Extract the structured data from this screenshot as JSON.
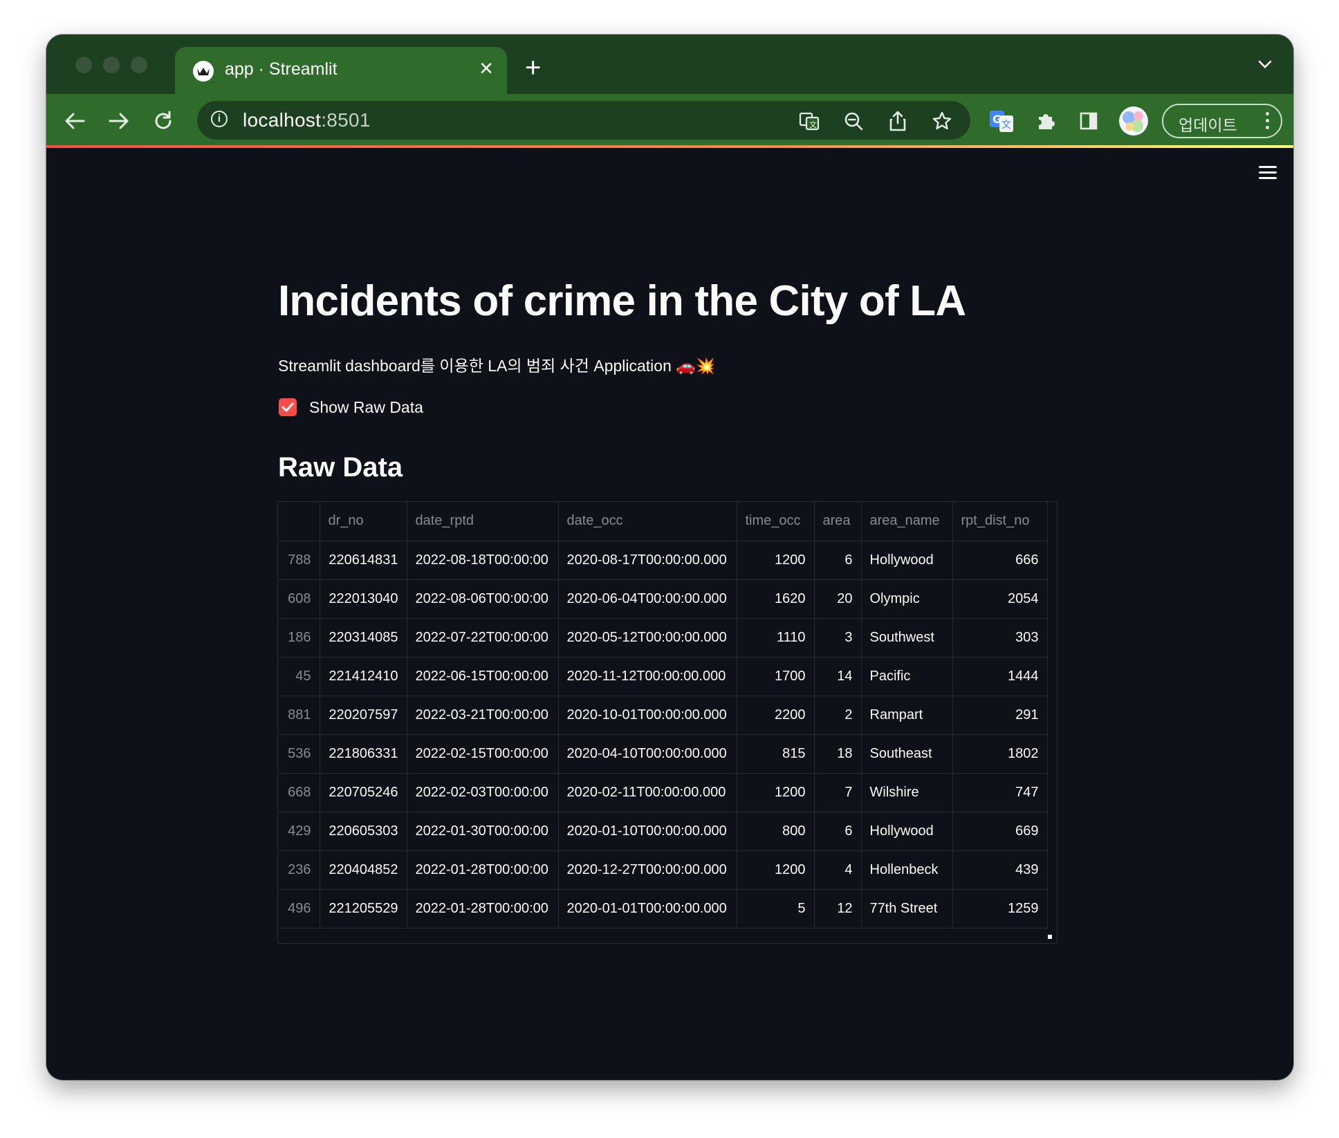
{
  "browser": {
    "tab_title": "app · Streamlit",
    "url_host": "localhost",
    "url_port": ":8501",
    "update_label": "업데이트"
  },
  "app": {
    "title": "Incidents of crime in the City of LA",
    "subtitle": "Streamlit dashboard를 이용한 LA의 범죄 사건 Application 🚗💥",
    "checkbox_label": "Show Raw Data",
    "checkbox_checked": true,
    "section_title": "Raw Data"
  },
  "table": {
    "columns": [
      "",
      "dr_no",
      "date_rptd",
      "date_occ",
      "time_occ",
      "area",
      "area_name",
      "rpt_dist_no"
    ],
    "rows": [
      [
        "788",
        "220614831",
        "2022-08-18T00:00:00",
        "2020-08-17T00:00:00.000",
        "1200",
        "6",
        "Hollywood",
        "666"
      ],
      [
        "608",
        "222013040",
        "2022-08-06T00:00:00",
        "2020-06-04T00:00:00.000",
        "1620",
        "20",
        "Olympic",
        "2054"
      ],
      [
        "186",
        "220314085",
        "2022-07-22T00:00:00",
        "2020-05-12T00:00:00.000",
        "1110",
        "3",
        "Southwest",
        "303"
      ],
      [
        "45",
        "221412410",
        "2022-06-15T00:00:00",
        "2020-11-12T00:00:00.000",
        "1700",
        "14",
        "Pacific",
        "1444"
      ],
      [
        "881",
        "220207597",
        "2022-03-21T00:00:00",
        "2020-10-01T00:00:00.000",
        "2200",
        "2",
        "Rampart",
        "291"
      ],
      [
        "536",
        "221806331",
        "2022-02-15T00:00:00",
        "2020-04-10T00:00:00.000",
        "815",
        "18",
        "Southeast",
        "1802"
      ],
      [
        "668",
        "220705246",
        "2022-02-03T00:00:00",
        "2020-02-11T00:00:00.000",
        "1200",
        "7",
        "Wilshire",
        "747"
      ],
      [
        "429",
        "220605303",
        "2022-01-30T00:00:00",
        "2020-01-10T00:00:00.000",
        "800",
        "6",
        "Hollywood",
        "669"
      ],
      [
        "236",
        "220404852",
        "2022-01-28T00:00:00",
        "2020-12-27T00:00:00.000",
        "1200",
        "4",
        "Hollenbeck",
        "439"
      ],
      [
        "496",
        "221205529",
        "2022-01-28T00:00:00",
        "2020-01-01T00:00:00.000",
        "5",
        "12",
        "77th Street",
        "1259"
      ]
    ]
  },
  "colors": {
    "accent": "#ff4b4b",
    "app_background": "#0e1117",
    "browser_frame": "#2f6b2a"
  },
  "icons": [
    "streamlit-crown-icon",
    "close-icon",
    "new-tab-icon",
    "tab-dropdown-icon",
    "back-icon",
    "forward-icon",
    "reload-icon",
    "site-info-icon",
    "translate-icon",
    "zoom-out-icon",
    "share-icon",
    "bookmark-star-icon",
    "google-translate-extension-icon",
    "extensions-puzzle-icon",
    "side-panel-icon",
    "profile-avatar",
    "more-vertical-icon",
    "hamburger-menu-icon",
    "checkmark-icon"
  ]
}
